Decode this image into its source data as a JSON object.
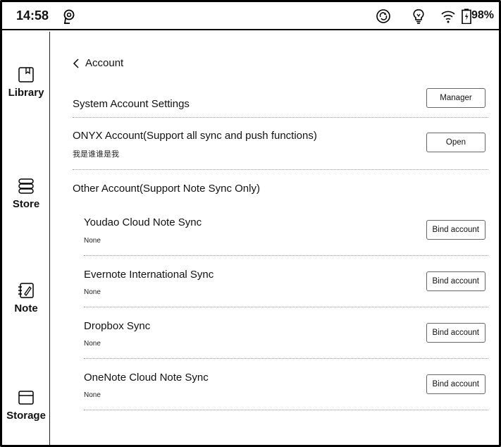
{
  "status_bar": {
    "time": "14:58",
    "battery_percent": "98%",
    "icons": [
      "push-notification-icon",
      "sync-icon",
      "bulb-icon",
      "wifi-icon",
      "battery-icon"
    ]
  },
  "sidebar": {
    "items": [
      {
        "label": "Library",
        "icon": "book-icon"
      },
      {
        "label": "Store",
        "icon": "store-icon"
      },
      {
        "label": "Note",
        "icon": "note-icon"
      },
      {
        "label": "Storage",
        "icon": "storage-icon"
      }
    ]
  },
  "header": {
    "back_label": "Account"
  },
  "rows": {
    "system": {
      "title": "System Account Settings",
      "button": "Manager"
    },
    "onyx": {
      "title": "ONYX Account(Support all sync and push functions)",
      "subtitle": "我是谁谁是我",
      "button": "Open"
    },
    "other": {
      "title": "Other Account(Support Note Sync Only)"
    },
    "accounts": [
      {
        "title": "Youdao Cloud Note Sync",
        "status": "None",
        "button": "Bind account"
      },
      {
        "title": "Evernote International Sync",
        "status": "None",
        "button": "Bind account"
      },
      {
        "title": "Dropbox Sync",
        "status": "None",
        "button": "Bind account"
      },
      {
        "title": "OneNote Cloud Note Sync",
        "status": "None",
        "button": "Bind account"
      }
    ]
  }
}
